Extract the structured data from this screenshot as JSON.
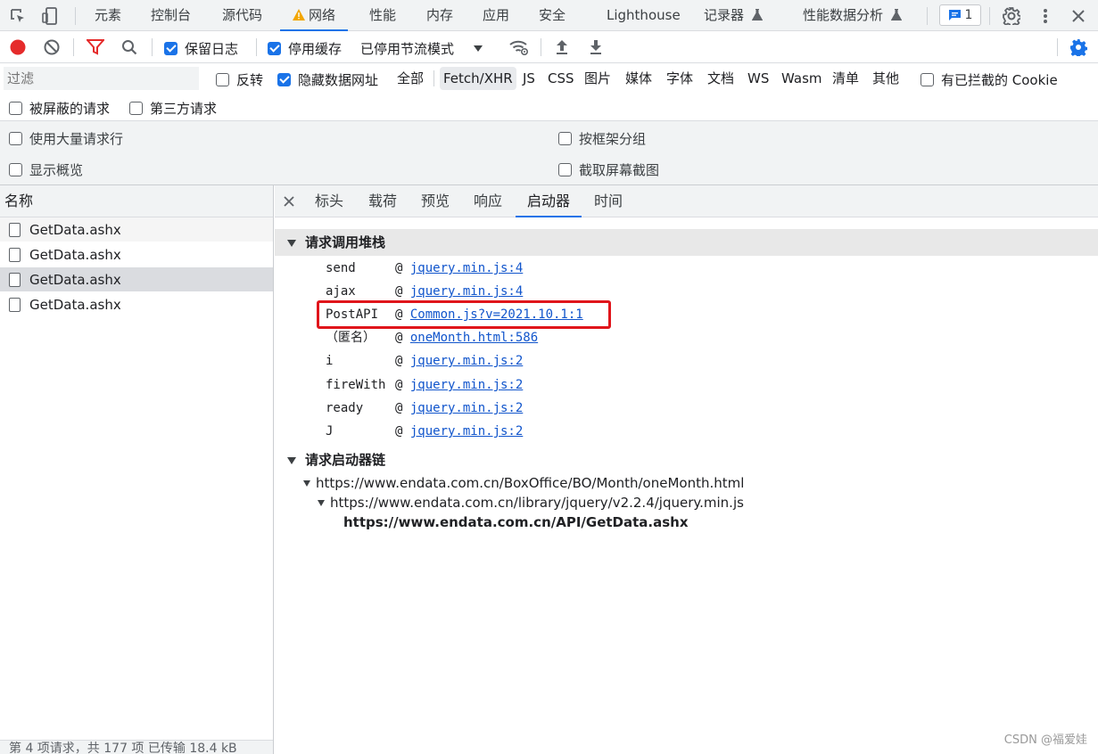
{
  "top_tabs": [
    "元素",
    "控制台",
    "源代码",
    "网络",
    "性能",
    "内存",
    "应用",
    "安全",
    "Lighthouse",
    "记录器",
    "性能数据分析"
  ],
  "issues_count": "1",
  "toolbar": {
    "preserve_log": "保留日志",
    "disable_cache": "停用缓存",
    "throttling": "已停用节流模式"
  },
  "filter": {
    "placeholder": "过滤",
    "invert": "反转",
    "hide_data_urls": "隐藏数据网址",
    "types": [
      "全部",
      "Fetch/XHR",
      "JS",
      "CSS",
      "图片",
      "媒体",
      "字体",
      "文档",
      "WS",
      "Wasm",
      "清单",
      "其他"
    ],
    "blocked_cookies": "有已拦截的 Cookie",
    "blocked_requests": "被屏蔽的请求",
    "third_party": "第三方请求"
  },
  "settings": {
    "large_rows": "使用大量请求行",
    "group_by_frame": "按框架分组",
    "show_overview": "显示概览",
    "capture_screenshots": "截取屏幕截图"
  },
  "requests": {
    "header": "名称",
    "items": [
      "GetData.ashx",
      "GetData.ashx",
      "GetData.ashx",
      "GetData.ashx"
    ],
    "status": "第 4 项请求，共 177 项   已传输 18.4 kB"
  },
  "detail_tabs": [
    "标头",
    "载荷",
    "预览",
    "响应",
    "启动器",
    "时间"
  ],
  "stack": {
    "title": "请求调用堆栈",
    "frames": [
      {
        "fn": "send",
        "src": "jquery.min.js:4"
      },
      {
        "fn": "ajax",
        "src": "jquery.min.js:4"
      },
      {
        "fn": "PostAPI",
        "src": "Common.js?v=2021.10.1:1"
      },
      {
        "fn": "（匿名）",
        "src": "oneMonth.html:586"
      },
      {
        "fn": "i",
        "src": "jquery.min.js:2"
      },
      {
        "fn": "fireWith",
        "src": "jquery.min.js:2"
      },
      {
        "fn": "ready",
        "src": "jquery.min.js:2"
      },
      {
        "fn": "J",
        "src": "jquery.min.js:2"
      }
    ]
  },
  "chain": {
    "title": "请求启动器链",
    "level1": "https://www.endata.com.cn/BoxOffice/BO/Month/oneMonth.html",
    "level2": "https://www.endata.com.cn/library/jquery/v2.2.4/jquery.min.js",
    "level3": "https://www.endata.com.cn/API/GetData.ashx"
  },
  "watermark": "CSDN @福爱娃"
}
